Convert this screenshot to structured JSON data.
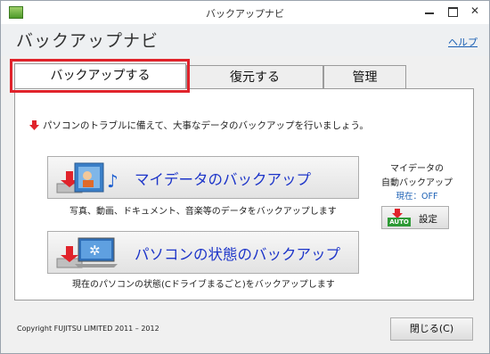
{
  "window": {
    "title": "バックアップナビ"
  },
  "header": {
    "heading": "バックアップナビ",
    "help_label": "ヘルプ"
  },
  "tabs": [
    {
      "label": "バックアップする",
      "active": true
    },
    {
      "label": "復元する",
      "active": false
    },
    {
      "label": "管理",
      "active": false
    }
  ],
  "main": {
    "intro_text": "パソコンのトラブルに備えて、大事なデータのバックアップを行いましょう。",
    "my_data": {
      "label": "マイデータのバックアップ",
      "description": "写真、動画、ドキュメント、音楽等のデータをバックアップします"
    },
    "pc_state": {
      "label": "パソコンの状態のバックアップ",
      "description": "現在のパソコンの状態(Cドライブまるごと)をバックアップします"
    },
    "auto_backup": {
      "title_line1": "マイデータの",
      "title_line2": "自動バックアップ",
      "status": "現在：OFF",
      "badge": "AUTO",
      "settings_label": "設定"
    }
  },
  "footer": {
    "copyright": "Copyright FUJITSU LIMITED 2011 – 2012",
    "close_label": "閉じる(C)"
  },
  "colors": {
    "accent_blue": "#1d35c9",
    "highlight_red": "#e0232b",
    "auto_green": "#2d9a35"
  }
}
